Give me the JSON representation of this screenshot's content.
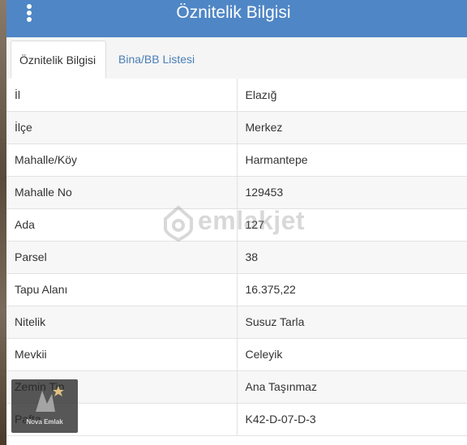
{
  "title": "Öznitelik Bilgisi",
  "tabs": [
    {
      "label": "Öznitelik Bilgisi",
      "active": true
    },
    {
      "label": "Bina/BB Listesi",
      "active": false
    }
  ],
  "rows": [
    {
      "key": "İl",
      "value": "Elazığ"
    },
    {
      "key": "İlçe",
      "value": "Merkez"
    },
    {
      "key": "Mahalle/Köy",
      "value": "Harmantepe"
    },
    {
      "key": "Mahalle No",
      "value": "129453"
    },
    {
      "key": "Ada",
      "value": "127"
    },
    {
      "key": "Parsel",
      "value": "38"
    },
    {
      "key": "Tapu Alanı",
      "value": "16.375,22"
    },
    {
      "key": "Nitelik",
      "value": "Susuz Tarla"
    },
    {
      "key": "Mevkii",
      "value": "Celeyik"
    },
    {
      "key": "Zemin Tip",
      "value": "Ana Taşınmaz"
    },
    {
      "key": "Pafta",
      "value": "K42-D-07-D-3"
    }
  ],
  "watermark": {
    "text": "emlakjet",
    "icon": "house-pin-icon"
  },
  "corner_logo": {
    "text": "Nova Emlak"
  },
  "colors": {
    "header": "#4f86c6",
    "tab_link": "#4a7fb5"
  },
  "icons": {
    "menu": "vertical-dots-icon"
  }
}
